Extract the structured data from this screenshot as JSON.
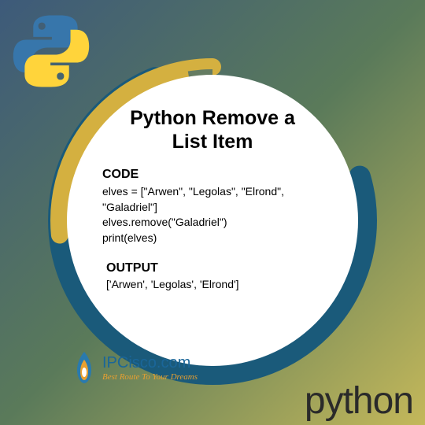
{
  "title_line1": "Python Remove a",
  "title_line2": "List Item",
  "code_label": "CODE",
  "code_line1": "elves = [\"Arwen\", \"Legolas\", \"Elrond\",",
  "code_line2": "\"Galadriel\"]",
  "code_line3": "elves.remove(\"Galadriel\")",
  "code_line4": "print(elves)",
  "output_label": "OUTPUT",
  "output_line1": "['Arwen', 'Legolas', 'Elrond']",
  "ipcisco_name": "IPCisco.com",
  "ipcisco_tagline": "Best Route To Your Dreams",
  "python_brand": "python"
}
